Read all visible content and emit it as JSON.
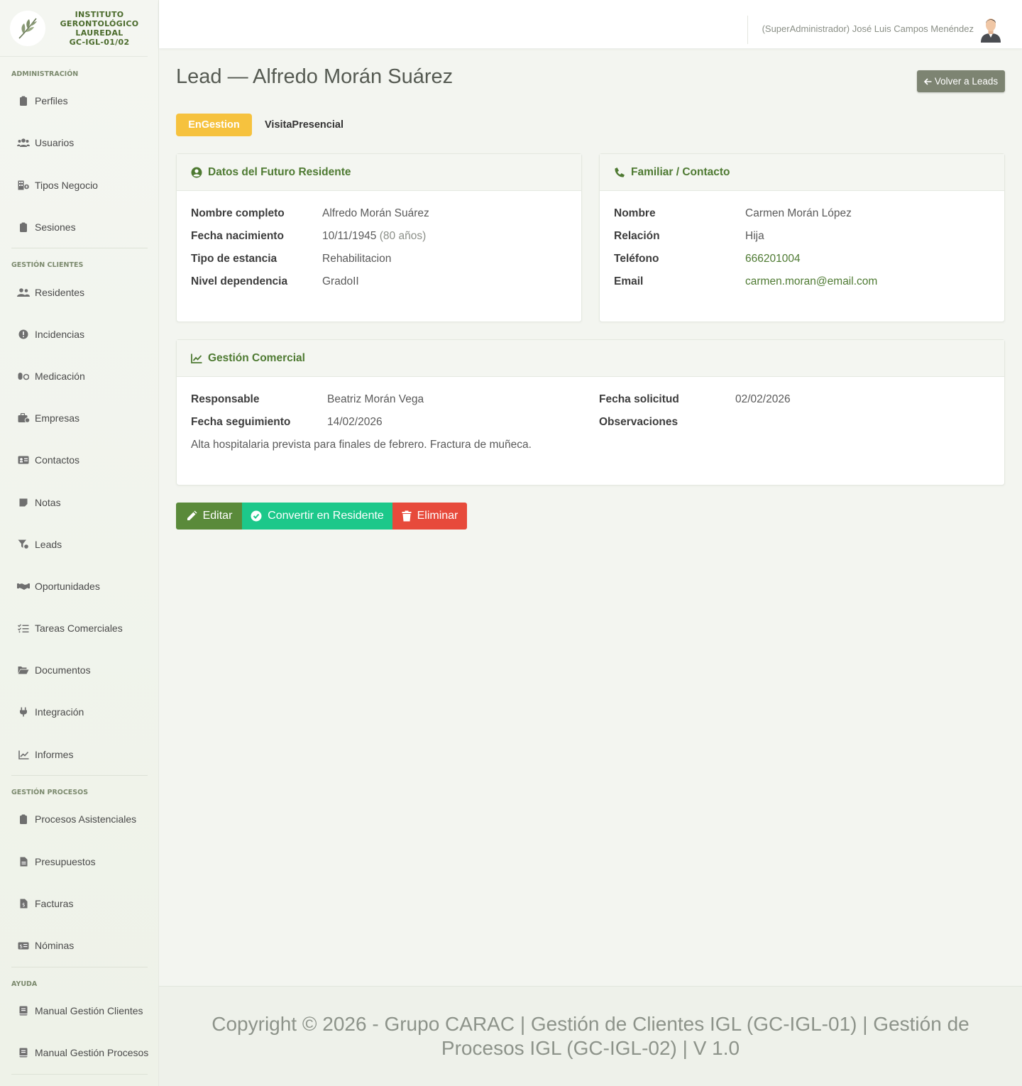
{
  "brand": {
    "line1": "INSTITUTO",
    "line2": "GERONTOLÓGICO",
    "line3": "LAUREDAL",
    "line4": "GC-IGL-01/02"
  },
  "sidebar": {
    "sections": [
      {
        "title": "ADMINISTRACIÓN"
      },
      {
        "title": "GESTIÓN CLIENTES"
      },
      {
        "title": "GESTIÓN PROCESOS"
      },
      {
        "title": "AYUDA"
      }
    ],
    "items": [
      {
        "label": "Perfiles",
        "icon": "clipboard-icon"
      },
      {
        "label": "Usuarios",
        "icon": "users-icon"
      },
      {
        "label": "Tipos Negocio",
        "icon": "building-icon"
      },
      {
        "label": "Sesiones",
        "icon": "clipboard-icon"
      },
      {
        "label": "Residentes",
        "icon": "user-group-icon"
      },
      {
        "label": "Incidencias",
        "icon": "exclamation-circle-icon"
      },
      {
        "label": "Medicación",
        "icon": "pills-icon"
      },
      {
        "label": "Empresas",
        "icon": "briefcase-icon"
      },
      {
        "label": "Contactos",
        "icon": "address-card-icon"
      },
      {
        "label": "Notas",
        "icon": "sticky-note-icon"
      },
      {
        "label": "Leads",
        "icon": "funnel-icon"
      },
      {
        "label": "Oportunidades",
        "icon": "handshake-icon"
      },
      {
        "label": "Tareas Comerciales",
        "icon": "list-check-icon"
      },
      {
        "label": "Documentos",
        "icon": "folder-open-icon"
      },
      {
        "label": "Integración",
        "icon": "plug-icon"
      },
      {
        "label": "Informes",
        "icon": "line-chart-icon"
      },
      {
        "label": "Procesos Asistenciales",
        "icon": "clipboard-icon"
      },
      {
        "label": "Presupuestos",
        "icon": "file-icon"
      },
      {
        "label": "Facturas",
        "icon": "invoice-icon"
      },
      {
        "label": "Nóminas",
        "icon": "money-icon"
      },
      {
        "label": "Manual Gestión Clientes",
        "icon": "book-icon"
      },
      {
        "label": "Manual Gestión Procesos",
        "icon": "book-icon"
      }
    ]
  },
  "topbar": {
    "user": "(SuperAdministrador) José Luis Campos Menéndez"
  },
  "page": {
    "title": "Lead — Alfredo Morán Suárez",
    "back_label": "Volver a Leads",
    "state_badge": "EnGestion",
    "origin": "VisitaPresencial"
  },
  "resident": {
    "header": "Datos del Futuro Residente",
    "name_label": "Nombre completo",
    "name": "Alfredo Morán Suárez",
    "birth_label": "Fecha nacimiento",
    "birth": "10/11/1945",
    "age": "(80 años)",
    "stay_label": "Tipo de estancia",
    "stay": "Rehabilitacion",
    "dependency_label": "Nivel dependencia",
    "dependency": "GradoII"
  },
  "contact": {
    "header": "Familiar / Contacto",
    "name_label": "Nombre",
    "name": "Carmen Morán López",
    "relation_label": "Relación",
    "relation": "Hija",
    "phone_label": "Teléfono",
    "phone": "666201004",
    "email_label": "Email",
    "email": "carmen.moran@email.com"
  },
  "commercial": {
    "header": "Gestión Comercial",
    "responsible_label": "Responsable",
    "responsible": "Beatriz Morán Vega",
    "request_label": "Fecha solicitud",
    "request": "02/02/2026",
    "followup_label": "Fecha seguimiento",
    "followup": "14/02/2026",
    "observations_label": "Observaciones",
    "observations": "Alta hospitalaria prevista para finales de febrero. Fractura de muñeca."
  },
  "actions": {
    "edit": "Editar",
    "convert": "Convertir en Residente",
    "delete": "Eliminar"
  },
  "footer": {
    "text": "Copyright © 2026 - Grupo CARAC | Gestión de Clientes IGL (GC-IGL-01) | Gestión de Procesos IGL (GC-IGL-02) | V 1.0"
  },
  "colors": {
    "primary_green": "#4e7a32",
    "edit_button": "#5a8a3a",
    "convert_button": "#1cc88a",
    "delete_button": "#e74a3b",
    "state_badge": "#f6c23e",
    "back_button": "#7d8472"
  }
}
